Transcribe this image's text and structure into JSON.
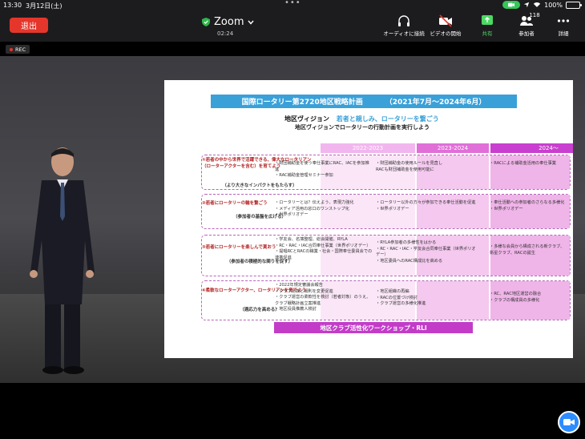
{
  "status_bar": {
    "time": "13:30",
    "date": "3月12日(土)",
    "battery": "100%"
  },
  "zoom": {
    "leave_label": "退出",
    "app_title": "Zoom",
    "timer": "02:24",
    "tools": {
      "audio": "オーディオに接続",
      "video": "ビデオの開始",
      "share": "共有",
      "participants": "参加者",
      "participants_count": "118",
      "more": "詳細"
    },
    "rec_label": "REC",
    "accent": "#2d8cff",
    "leave_color": "#e5362b",
    "share_color": "#4cd964"
  },
  "slide": {
    "title": "国際ロータリー第2720地区戦略計画",
    "period": "（2021年7月～2024年6月）",
    "vision_label": "地区ヴィジョン",
    "vision_text": "若者と親しみ、ロータリーを繋ごう",
    "vision_sub": "地区ヴィジョンでロータリーの行動計画を実行しよう",
    "columns": [
      "2022-2023",
      "2023-2024",
      "2024～"
    ],
    "rows": [
      {
        "label": "①若者の中から世界で活躍できる、偉大なロータリアン（ローターアクターを含む）を育てよう",
        "sub": "（より大きなインパクトをもたらす）",
        "c1": [
          "・財団補助金を使う奉仕事業にRAC、IACを参加推進",
          "・RAC補助金管理セミナー参加"
        ],
        "c2": [
          "・財団補助金の使用ルールを見直し",
          "RACも財団補助金を使用可能に"
        ],
        "c3": [
          "・RACによる補助金活用の奉仕事業"
        ]
      },
      {
        "label": "②若者にロータリーの輪を繋ごう",
        "sub": "（参加者の基盤を広げる）",
        "c1": [
          "・ロータリーとは？伝えよう、表現力強化",
          "・メディア活用の窓口のワンストップ化",
          "・世界ポリオデー"
        ],
        "c2": [
          "・ロータリー以外の方々が参加できる奉仕活動を促進",
          "・世界ポリオデー"
        ],
        "c3": [
          "・奉仕活動への参加者のさらなる多様化",
          "・世界ポリオデー"
        ]
      },
      {
        "label": "③若者にロータリーを楽しんで貰おう",
        "sub": "（参加者の積極的な関りを促す）",
        "c1": [
          "・学友会、名簿整理、総会開催、RYLA",
          "・RC・RAC・IAC合同奉仕事業（世界ポリオデー）",
          "・提唱RCとRACの職業・社会・国際奉仕委員会での連携促進"
        ],
        "c2": [
          "・RYLA参加者の多様性をはかる",
          "・RC・RAC・IAC・学友会合同奉仕事業（世界ポリオデー）",
          "・地区委員へのRAC構成比を高める"
        ],
        "c3": [
          "・多様な会員から構成される新クラブ、衛星クラブ、RACの誕生"
        ]
      },
      {
        "label": "④柔軟なローターアクター、ロータリアンを育てよう",
        "sub": "（適応力を高める）",
        "c1": [
          "・2022年規定審議会報告",
          "・クラブ定款と細則を変更促進",
          "・クラブ運営の柔軟性を検討（若者対象）のうえ、クラブ戦略計画立案推進",
          "・地区役員推薦人検討"
        ],
        "c2": [
          "・地区組織の再編",
          "・RACの位置づけ検討",
          "・クラブ運営の多様化推進"
        ],
        "c3": [
          "・RC、RAC地区運営の融合",
          "・クラブの構成員の多様化"
        ]
      }
    ],
    "footer": "地区クラブ活性化ワークショップ・RLI",
    "header_color": "#3aa0d8",
    "banner_color": "#c23cc8"
  }
}
